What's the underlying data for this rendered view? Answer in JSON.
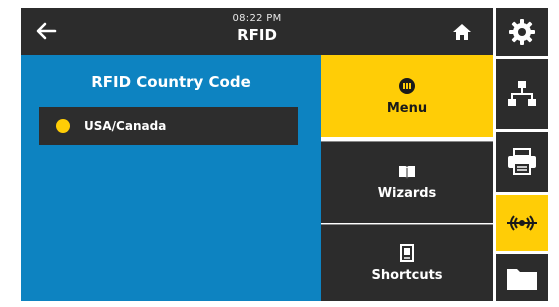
{
  "header": {
    "time": "08:22 PM",
    "title": "RFID",
    "back_icon": "back-arrow-icon",
    "home_icon": "home-icon"
  },
  "main": {
    "title": "RFID Country Code",
    "options": [
      {
        "label": "USA/Canada",
        "selected": true
      }
    ]
  },
  "actions": [
    {
      "label": "Menu",
      "icon": "menu-icon",
      "active": true
    },
    {
      "label": "Wizards",
      "icon": "wizards-book-icon",
      "active": false
    },
    {
      "label": "Shortcuts",
      "icon": "shortcuts-icon",
      "active": false
    }
  ],
  "sidebar": {
    "items": [
      {
        "icon": "gear-icon",
        "active": false
      },
      {
        "icon": "network-icon",
        "active": false
      },
      {
        "icon": "printer-icon",
        "active": false
      },
      {
        "icon": "rfid-icon",
        "active": true
      },
      {
        "icon": "folder-icon",
        "active": false
      }
    ]
  },
  "colors": {
    "panel_blue": "#0d83c1",
    "accent_yellow": "#ffcd06",
    "dark": "#2c2c2c"
  }
}
